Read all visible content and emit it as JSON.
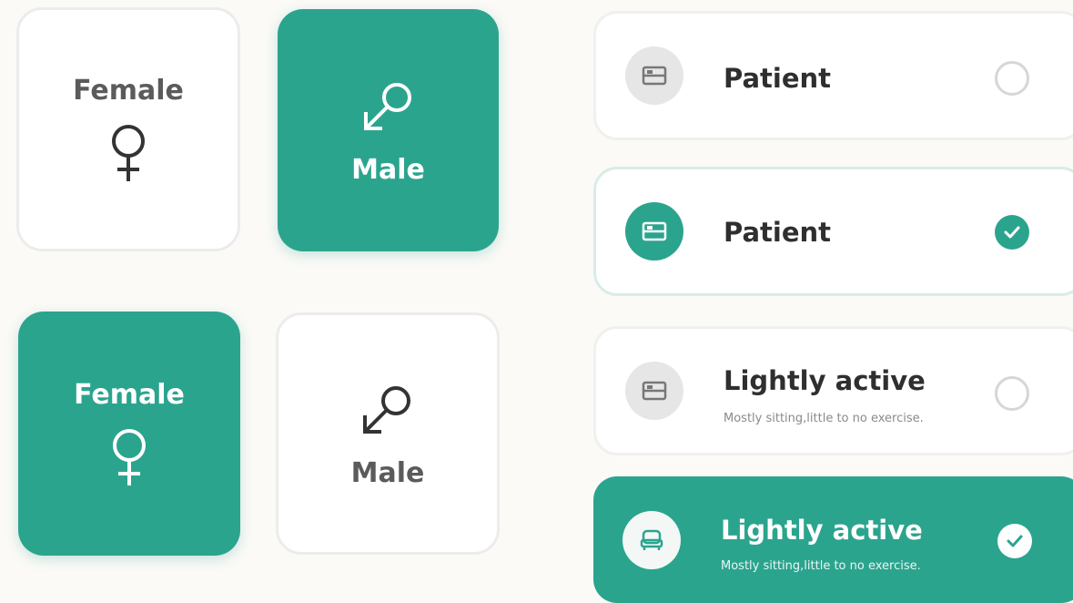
{
  "gender_cards": [
    {
      "label": "Female",
      "selected": false,
      "icon": "female-icon"
    },
    {
      "label": "Male",
      "selected": true,
      "icon": "male-icon"
    },
    {
      "label": "Female",
      "selected": true,
      "icon": "female-icon"
    },
    {
      "label": "Male",
      "selected": false,
      "icon": "male-icon"
    }
  ],
  "options": [
    {
      "title": "Patient",
      "subtitle": "",
      "state": "unselected",
      "icon": "bed-icon"
    },
    {
      "title": "Patient",
      "subtitle": "",
      "state": "selected",
      "icon": "bed-icon"
    },
    {
      "title": "Lightly active",
      "subtitle": "Mostly sitting,little to no exercise.",
      "state": "unselected",
      "icon": "bed-icon"
    },
    {
      "title": "Lightly active",
      "subtitle": "Mostly sitting,little to no exercise.",
      "state": "selected",
      "icon": "armchair-icon"
    }
  ],
  "colors": {
    "accent": "#2ba48e",
    "card_border": "#ececec",
    "text_dark": "#2f2f2f",
    "text_muted": "#8a8a8a",
    "background": "#fbfaf7"
  }
}
